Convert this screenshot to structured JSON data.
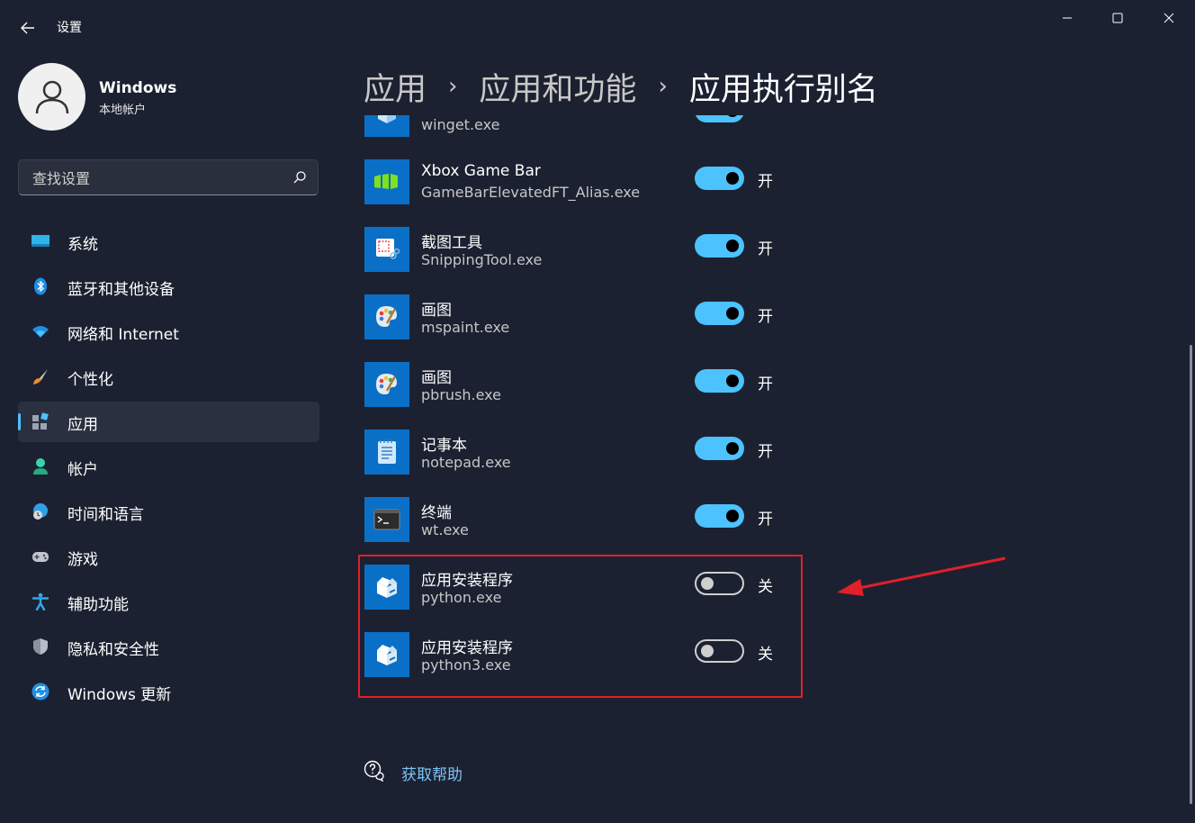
{
  "window": {
    "title": "设置",
    "controls": {
      "minimize": "–",
      "maximize": "☐",
      "close": "✕"
    }
  },
  "user": {
    "name": "Windows",
    "account_type": "本地帐户"
  },
  "search": {
    "placeholder": "查找设置"
  },
  "sidebar": {
    "items": [
      {
        "label": "系统",
        "icon": "monitor-icon",
        "selected": false
      },
      {
        "label": "蓝牙和其他设备",
        "icon": "bluetooth-icon",
        "selected": false
      },
      {
        "label": "网络和 Internet",
        "icon": "wifi-icon",
        "selected": false
      },
      {
        "label": "个性化",
        "icon": "brush-icon",
        "selected": false
      },
      {
        "label": "应用",
        "icon": "apps-icon",
        "selected": true
      },
      {
        "label": "帐户",
        "icon": "person-icon",
        "selected": false
      },
      {
        "label": "时间和语言",
        "icon": "globe-clock-icon",
        "selected": false
      },
      {
        "label": "游戏",
        "icon": "gamepad-icon",
        "selected": false
      },
      {
        "label": "辅助功能",
        "icon": "accessibility-icon",
        "selected": false
      },
      {
        "label": "隐私和安全性",
        "icon": "shield-icon",
        "selected": false
      },
      {
        "label": "Windows 更新",
        "icon": "update-icon",
        "selected": false
      }
    ]
  },
  "breadcrumb": {
    "items": [
      "应用",
      "应用和功能",
      "应用执行别名"
    ],
    "separator": "›"
  },
  "aliases": [
    {
      "name": "",
      "exe": "winget.exe",
      "enabled": true,
      "state_label": "",
      "icon": "winget-icon"
    },
    {
      "name": "Xbox Game Bar",
      "exe": "GameBarElevatedFT_Alias.exe",
      "enabled": true,
      "state_label": "开",
      "icon": "xbox-game-bar-icon"
    },
    {
      "name": "截图工具",
      "exe": "SnippingTool.exe",
      "enabled": true,
      "state_label": "开",
      "icon": "snipping-tool-icon"
    },
    {
      "name": "画图",
      "exe": "mspaint.exe",
      "enabled": true,
      "state_label": "开",
      "icon": "paint-icon"
    },
    {
      "name": "画图",
      "exe": "pbrush.exe",
      "enabled": true,
      "state_label": "开",
      "icon": "paint-icon"
    },
    {
      "name": "记事本",
      "exe": "notepad.exe",
      "enabled": true,
      "state_label": "开",
      "icon": "notepad-icon"
    },
    {
      "name": "终端",
      "exe": "wt.exe",
      "enabled": true,
      "state_label": "开",
      "icon": "terminal-icon"
    },
    {
      "name": "应用安装程序",
      "exe": "python.exe",
      "enabled": false,
      "state_label": "关",
      "icon": "app-installer-icon"
    },
    {
      "name": "应用安装程序",
      "exe": "python3.exe",
      "enabled": false,
      "state_label": "关",
      "icon": "app-installer-icon"
    }
  ],
  "help": {
    "label": "获取帮助"
  },
  "colors": {
    "accent": "#4cc2ff",
    "background": "#1c2131",
    "annotation": "#e0202a",
    "app_icon_bg": "#0a6fc7"
  }
}
